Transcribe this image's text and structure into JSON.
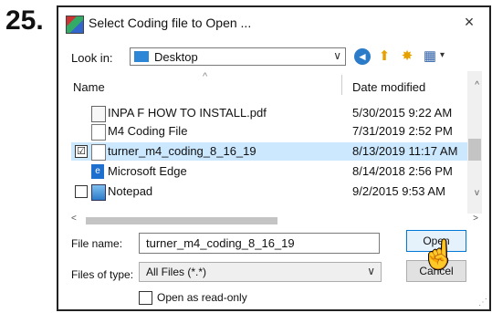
{
  "step_number": "25.",
  "dialog": {
    "title": "Select Coding file to Open ...",
    "close_label": "×"
  },
  "lookin": {
    "label": "Look in:",
    "value": "Desktop",
    "chevron": "∨"
  },
  "toolbar": {
    "back_icon": "◄",
    "up_icon": "⬆",
    "new_folder_icon": "✸",
    "views_icon": "▦",
    "views_chevron": "▾"
  },
  "list": {
    "columns": {
      "name": "Name",
      "date": "Date modified"
    },
    "sort_arrow": "^",
    "files": [
      {
        "name": "INPA F HOW TO INSTALL.pdf",
        "date": "5/30/2015 9:22 AM",
        "icon": "pdf-icon",
        "selected": false,
        "checkbox": false
      },
      {
        "name": "M4 Coding File",
        "date": "7/31/2019 2:52 PM",
        "icon": "file-icon",
        "selected": false,
        "checkbox": false
      },
      {
        "name": "turner_m4_coding_8_16_19",
        "date": "8/13/2019 11:17 AM",
        "icon": "file-icon",
        "selected": true,
        "checkbox": true,
        "checkbox_mark": "☑"
      },
      {
        "name": "Microsoft Edge",
        "date": "8/14/2018 2:56 PM",
        "icon": "edge-icon",
        "selected": false,
        "checkbox": false
      },
      {
        "name": "Notepad",
        "date": "9/2/2015 9:53 AM",
        "icon": "notepad-icon",
        "selected": false,
        "checkbox": true,
        "checkbox_mark": ""
      }
    ],
    "scroll": {
      "up": "^",
      "down": "v",
      "left": "<",
      "right": ">"
    }
  },
  "filename": {
    "label": "File name:",
    "value": "turner_m4_coding_8_16_19"
  },
  "filetype": {
    "label": "Files of type:",
    "value": "All Files (*.*)",
    "chevron": "∨"
  },
  "buttons": {
    "open": "Open",
    "cancel": "Cancel"
  },
  "readonly": {
    "label": "Open as read-only"
  },
  "cursor": "☝",
  "resize_grip": "⋰"
}
